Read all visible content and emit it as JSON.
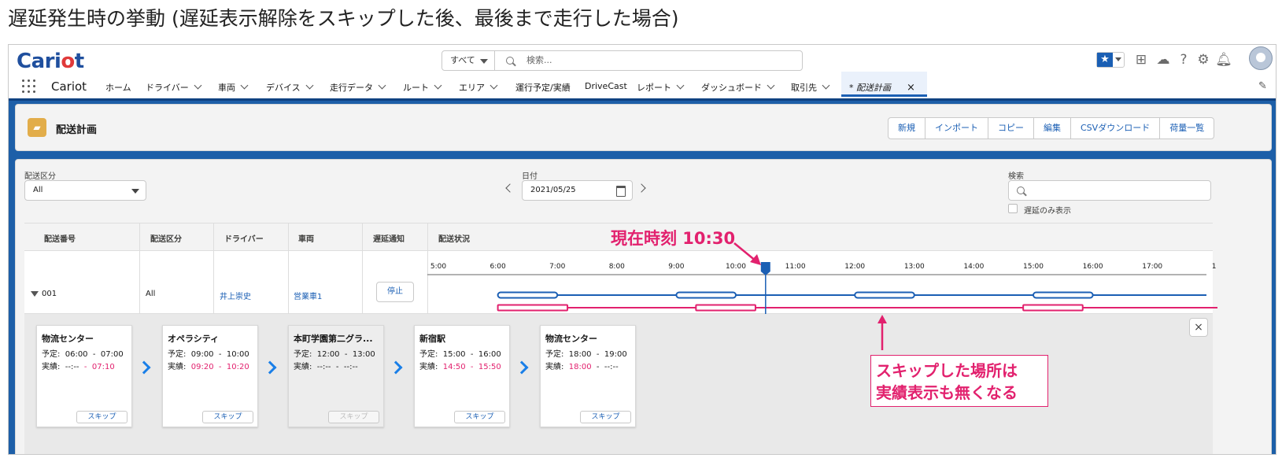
{
  "caption": "遅延発生時の挙動 (遅延表示解除をスキップした後、最後まで走行した場合)",
  "header": {
    "logo_main": "Cari",
    "logo_accent": "o",
    "logo_end": "t",
    "search_scope": "すべて",
    "search_placeholder": "検索...",
    "icons": [
      "star-icon",
      "plus-icon",
      "cloud-icon",
      "help-icon",
      "gear-icon",
      "bell-icon",
      "avatar"
    ]
  },
  "nav": {
    "app_name": "Cariot",
    "items": [
      "ホーム",
      "ドライバー",
      "車両",
      "デバイス",
      "走行データ",
      "ルート",
      "エリア",
      "運行予定/実績",
      "DriveCast",
      "レポート",
      "ダッシュボード",
      "取引先"
    ],
    "active_tab": "* 配送計画"
  },
  "page": {
    "title": "配送計画",
    "buttons": [
      "新規",
      "インポート",
      "コピー",
      "編集",
      "CSVダウンロード",
      "荷量一覧"
    ]
  },
  "filters": {
    "category_label": "配送区分",
    "category_value": "All",
    "date_label": "日付",
    "date_value": "2021/05/25",
    "search_label": "検索",
    "delay_only_label": "遅延のみ表示"
  },
  "table": {
    "headers": [
      "配送番号",
      "配送区分",
      "ドライバー",
      "車両",
      "遅延通知",
      "配送状況"
    ],
    "row": {
      "number": "001",
      "category": "All",
      "driver": "井上崇史",
      "vehicle": "営業車1",
      "notify_button": "停止"
    }
  },
  "timeline": {
    "hours": [
      "5:00",
      "6:00",
      "7:00",
      "8:00",
      "9:00",
      "10:00",
      "11:00",
      "12:00",
      "13:00",
      "14:00",
      "15:00",
      "16:00",
      "17:00",
      "1"
    ],
    "current_time": "10:30",
    "planned_color": "#1b5fb4",
    "actual_color": "#e2216e",
    "planned_segments": [
      [
        6.0,
        7.0
      ],
      [
        9.0,
        10.0
      ],
      [
        12.0,
        13.0
      ],
      [
        15.0,
        16.0
      ]
    ],
    "actual_segments": [
      [
        6.0,
        7.17
      ],
      [
        9.33,
        10.33
      ],
      [
        14.83,
        15.83
      ]
    ]
  },
  "stops": [
    {
      "name": "物流センター",
      "plan_label": "予定:",
      "plan_from": "06:00",
      "plan_to": "07:00",
      "actual_label": "実績:",
      "actual_from": "--:--",
      "actual_to": "07:10",
      "skip": "スキップ",
      "skipped": false
    },
    {
      "name": "オペラシティ",
      "plan_label": "予定:",
      "plan_from": "09:00",
      "plan_to": "10:00",
      "actual_label": "実績:",
      "actual_from": "09:20",
      "actual_to": "10:20",
      "skip": "スキップ",
      "skipped": false
    },
    {
      "name": "本町学園第二グラ...",
      "plan_label": "予定:",
      "plan_from": "12:00",
      "plan_to": "13:00",
      "actual_label": "実績:",
      "actual_from": "--:--",
      "actual_to": "--:--",
      "skip": "スキップ",
      "skipped": true
    },
    {
      "name": "新宿駅",
      "plan_label": "予定:",
      "plan_from": "15:00",
      "plan_to": "16:00",
      "actual_label": "実績:",
      "actual_from": "14:50",
      "actual_to": "15:50",
      "skip": "スキップ",
      "skipped": false
    },
    {
      "name": "物流センター",
      "plan_label": "予定:",
      "plan_from": "18:00",
      "plan_to": "19:00",
      "actual_label": "実績:",
      "actual_from": "18:00",
      "actual_to": "--:--",
      "skip": "スキップ",
      "skipped": false
    }
  ],
  "annotations": {
    "current_time": "現在時刻 10:30",
    "skip_note_line1": "スキップした場所は",
    "skip_note_line2": "実績表示も無くなる",
    "color": "#e2216e"
  },
  "close": "×"
}
